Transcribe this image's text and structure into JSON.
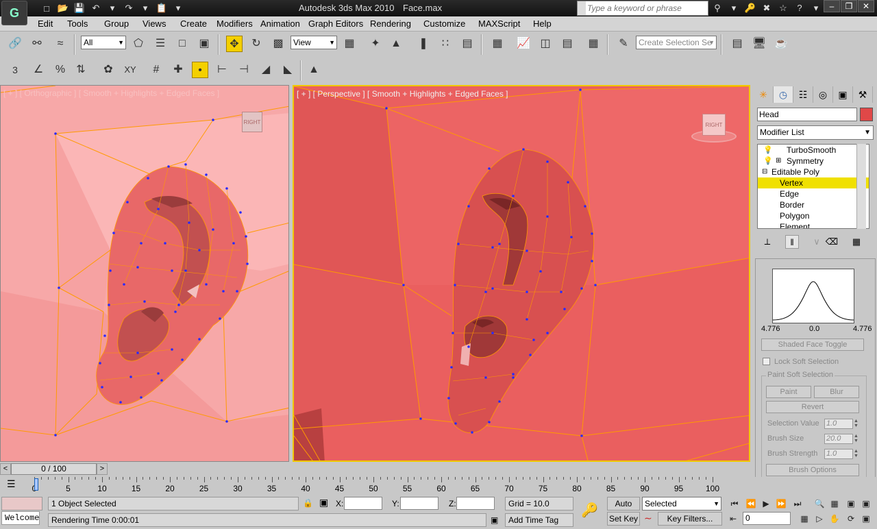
{
  "titlebar": {
    "app_title": "Autodesk 3ds Max  2010",
    "file_name": "Face.max",
    "search_placeholder": "Type a keyword or phrase",
    "logo_glyph": "G"
  },
  "menu": [
    "Edit",
    "Tools",
    "Group",
    "Views",
    "Create",
    "Modifiers",
    "Animation",
    "Graph Editors",
    "Rendering",
    "Customize",
    "MAXScript",
    "Help"
  ],
  "toolbar": {
    "selection_filter": "All",
    "ref_coord": "View",
    "named_selection_placeholder": "Create Selection Se"
  },
  "snap_toolbar": {
    "snap_label": "3",
    "angle_label": "XY"
  },
  "viewports": {
    "left_label": "[ + ] [ Orthographic ] [ Smooth + Highlights + Edged Faces ]",
    "right_label": "[ + ] [ Perspective ] [ Smooth + Highlights + Edged Faces ]",
    "viewcube_label": "RIGHT"
  },
  "command_panel": {
    "object_name": "Head",
    "modifier_list": "Modifier List",
    "stack": [
      {
        "label": "TurboSmooth",
        "indent": 0
      },
      {
        "label": "Symmetry",
        "indent": 0
      },
      {
        "label": "Editable Poly",
        "indent": 0
      },
      {
        "label": "Vertex",
        "indent": 1,
        "selected": true
      },
      {
        "label": "Edge",
        "indent": 1
      },
      {
        "label": "Border",
        "indent": 1
      },
      {
        "label": "Polygon",
        "indent": 1
      },
      {
        "label": "Element",
        "indent": 1
      }
    ],
    "falloff_left": "4.776",
    "falloff_mid": "0.0",
    "falloff_right": "4.776",
    "shaded_face_toggle": "Shaded Face Toggle",
    "lock_soft_selection": "Lock Soft Selection",
    "paint_group_title": "Paint Soft Selection",
    "paint_btn": "Paint",
    "blur_btn": "Blur",
    "revert_btn": "Revert",
    "selection_value_label": "Selection Value",
    "selection_value": "1.0",
    "brush_size_label": "Brush Size",
    "brush_size": "20.0",
    "brush_strength_label": "Brush Strength",
    "brush_strength": "1.0",
    "brush_options_btn": "Brush Options"
  },
  "timeline": {
    "frame_display": "0 / 100",
    "ticks": [
      0,
      5,
      10,
      15,
      20,
      25,
      30,
      35,
      40,
      45,
      50,
      55,
      60,
      65,
      70,
      75,
      80,
      85,
      90,
      95,
      100
    ]
  },
  "status": {
    "maxscript_listener": "Welcome",
    "selection_info": "1 Object Selected",
    "prompt": "Rendering Time  0:00:01",
    "x_label": "X:",
    "y_label": "Y:",
    "z_label": "Z:",
    "grid": "Grid = 10.0",
    "add_time_tag": "Add Time Tag",
    "auto_key": "Auto Key",
    "set_key": "Set Key",
    "key_mode": "Selected",
    "key_filters": "Key Filters...",
    "current_frame": "0"
  },
  "colors": {
    "viewport_active_border": "#f0c800",
    "selected_stack_item": "#f0e000",
    "mesh_edge": "#ff9a00",
    "vertex": "#3a3aff"
  }
}
